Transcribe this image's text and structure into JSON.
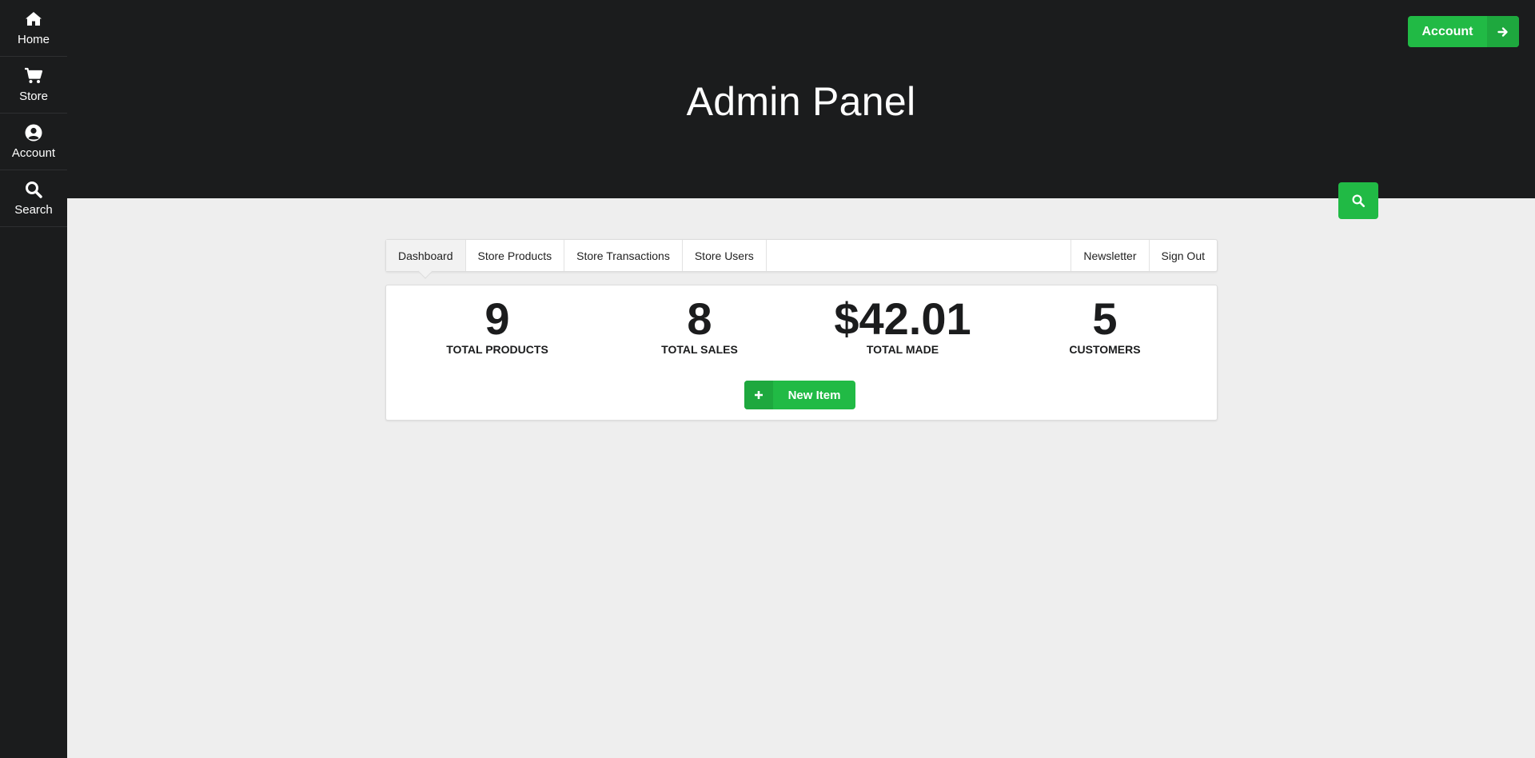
{
  "sidebar": {
    "items": [
      {
        "label": "Home",
        "icon": "home-icon"
      },
      {
        "label": "Store",
        "icon": "cart-icon"
      },
      {
        "label": "Account",
        "icon": "user-circle-icon"
      },
      {
        "label": "Search",
        "icon": "search-icon"
      }
    ]
  },
  "header": {
    "title": "Admin Panel",
    "account_button": {
      "label": "Account",
      "icon": "arrow-right-icon"
    },
    "search_button": {
      "icon": "search-icon"
    }
  },
  "tabs": {
    "left": [
      "Dashboard",
      "Store Products",
      "Store Transactions",
      "Store Users"
    ],
    "right": [
      "Newsletter",
      "Sign Out"
    ],
    "active": "Dashboard"
  },
  "stats": [
    {
      "value": "9",
      "label": "TOTAL PRODUCTS"
    },
    {
      "value": "8",
      "label": "TOTAL SALES"
    },
    {
      "value": "$42.01",
      "label": "TOTAL MADE"
    },
    {
      "value": "5",
      "label": "CUSTOMERS"
    }
  ],
  "new_item_button": {
    "label": "New Item",
    "icon": "plus-icon"
  },
  "colors": {
    "dark": "#1b1c1d",
    "background": "#eeeeee",
    "green": "#21ba45"
  }
}
